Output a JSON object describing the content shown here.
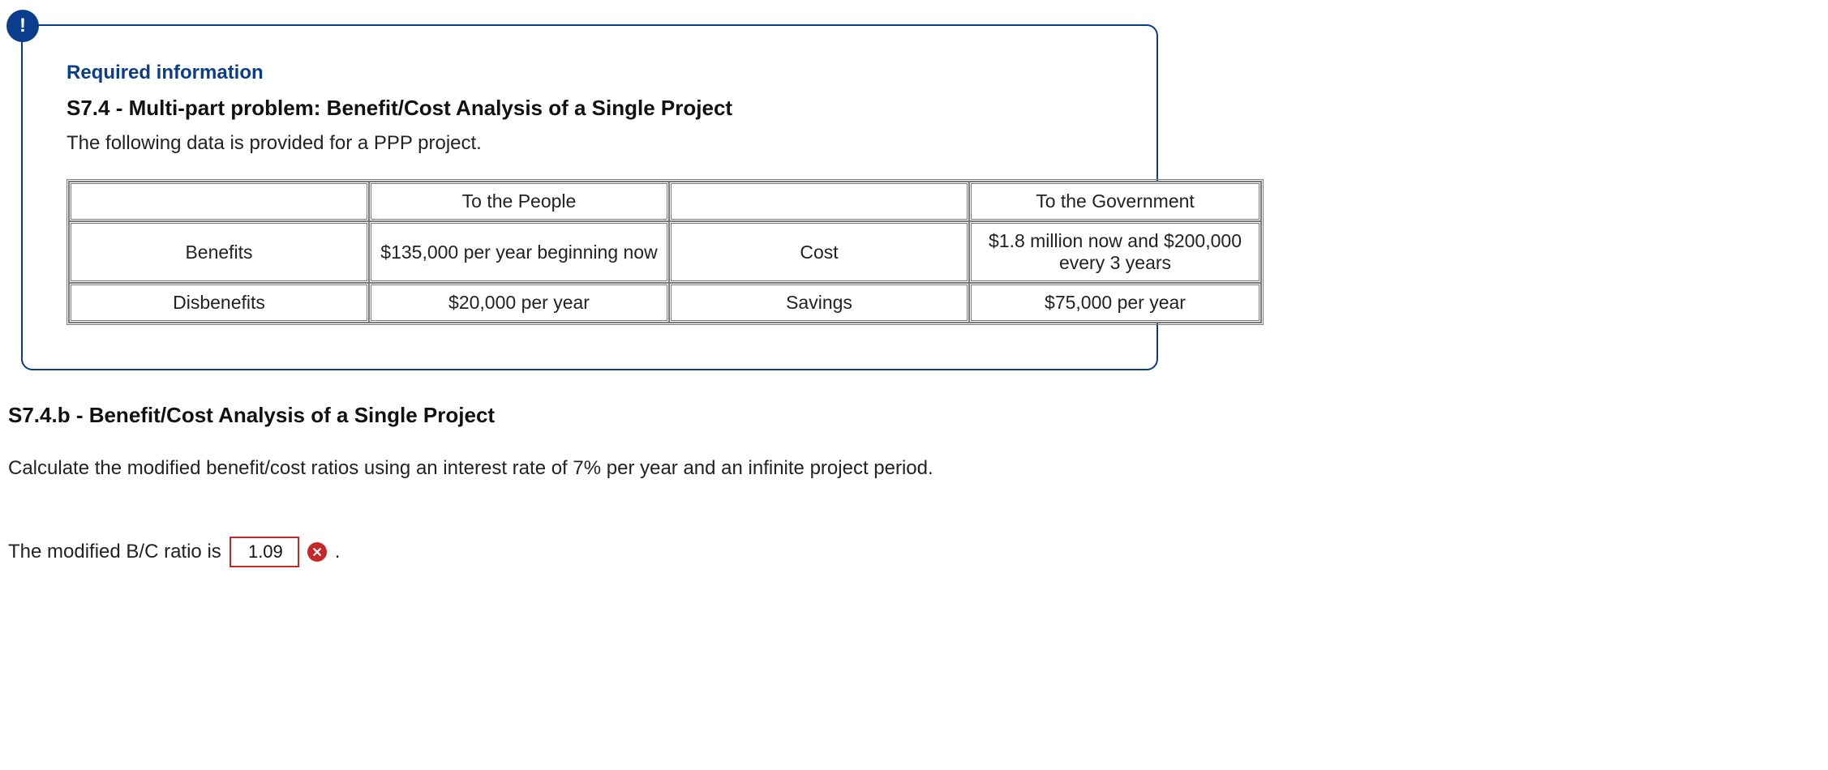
{
  "badge_glyph": "!",
  "required_heading": "Required information",
  "section_title": "S7.4 - Multi-part problem: Benefit/Cost Analysis of a Single Project",
  "lead_text": "The following data is provided for a PPP project.",
  "table": {
    "header_people": "To the People",
    "header_gov": "To the Government",
    "rows": [
      {
        "left_label": "Benefits",
        "people_val": "$135,000 per year beginning now",
        "right_label": "Cost",
        "gov_val": "$1.8 million now and $200,000 every 3 years"
      },
      {
        "left_label": "Disbenefits",
        "people_val": "$20,000 per year",
        "right_label": "Savings",
        "gov_val": "$75,000 per year"
      }
    ]
  },
  "sub_title": "S7.4.b - Benefit/Cost Analysis of a Single Project",
  "prompt": "Calculate the modified benefit/cost ratios using an interest rate of 7% per year and an infinite project period.",
  "answer_prefix": "The modified B/C ratio is",
  "answer_value": "1.09",
  "answer_suffix": ".",
  "colors": {
    "brand": "#0a3e8c",
    "error": "#c62828"
  }
}
